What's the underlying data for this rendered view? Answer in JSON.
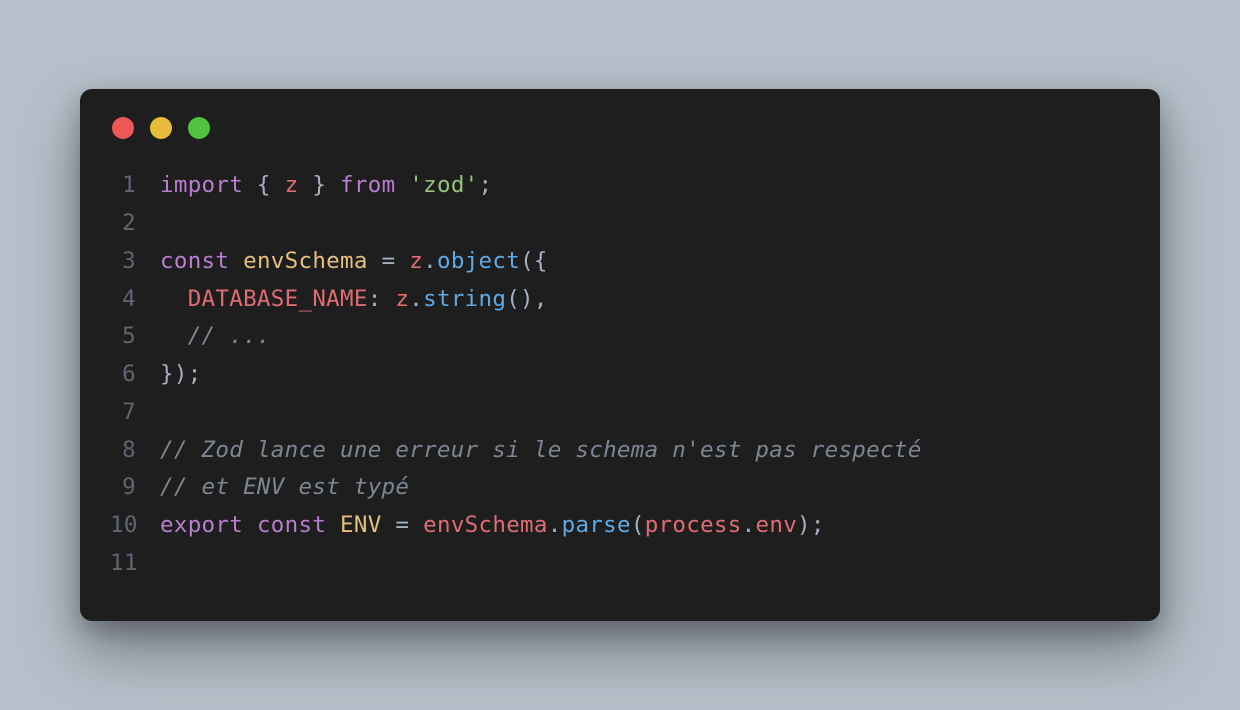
{
  "trafficLights": [
    "red",
    "yellow",
    "green"
  ],
  "lines": [
    {
      "num": "1",
      "tokens": [
        {
          "cls": "tok-keyword",
          "text": "import"
        },
        {
          "cls": "tok-punct",
          "text": " { "
        },
        {
          "cls": "tok-variable",
          "text": "z"
        },
        {
          "cls": "tok-punct",
          "text": " } "
        },
        {
          "cls": "tok-from",
          "text": "from"
        },
        {
          "cls": "tok-punct",
          "text": " "
        },
        {
          "cls": "tok-string",
          "text": "'zod'"
        },
        {
          "cls": "tok-punct",
          "text": ";"
        }
      ]
    },
    {
      "num": "2",
      "tokens": []
    },
    {
      "num": "3",
      "tokens": [
        {
          "cls": "tok-keyword",
          "text": "const"
        },
        {
          "cls": "tok-punct",
          "text": " "
        },
        {
          "cls": "tok-ident",
          "text": "envSchema"
        },
        {
          "cls": "tok-punct",
          "text": " = "
        },
        {
          "cls": "tok-variable",
          "text": "z"
        },
        {
          "cls": "tok-punct",
          "text": "."
        },
        {
          "cls": "tok-method",
          "text": "object"
        },
        {
          "cls": "tok-punct",
          "text": "({"
        }
      ]
    },
    {
      "num": "4",
      "tokens": [
        {
          "cls": "tok-punct",
          "text": "  "
        },
        {
          "cls": "tok-property",
          "text": "DATABASE_NAME"
        },
        {
          "cls": "tok-punct",
          "text": ": "
        },
        {
          "cls": "tok-variable",
          "text": "z"
        },
        {
          "cls": "tok-punct",
          "text": "."
        },
        {
          "cls": "tok-method",
          "text": "string"
        },
        {
          "cls": "tok-punct",
          "text": "(),"
        }
      ]
    },
    {
      "num": "5",
      "tokens": [
        {
          "cls": "tok-punct",
          "text": "  "
        },
        {
          "cls": "tok-comment",
          "text": "// ..."
        }
      ]
    },
    {
      "num": "6",
      "tokens": [
        {
          "cls": "tok-punct",
          "text": "});"
        }
      ]
    },
    {
      "num": "7",
      "tokens": []
    },
    {
      "num": "8",
      "tokens": [
        {
          "cls": "tok-comment",
          "text": "// Zod lance une erreur si le schema n'est pas respecté"
        }
      ]
    },
    {
      "num": "9",
      "tokens": [
        {
          "cls": "tok-comment",
          "text": "// et ENV est typé"
        }
      ]
    },
    {
      "num": "10",
      "tokens": [
        {
          "cls": "tok-keyword",
          "text": "export"
        },
        {
          "cls": "tok-punct",
          "text": " "
        },
        {
          "cls": "tok-keyword",
          "text": "const"
        },
        {
          "cls": "tok-punct",
          "text": " "
        },
        {
          "cls": "tok-const",
          "text": "ENV"
        },
        {
          "cls": "tok-punct",
          "text": " = "
        },
        {
          "cls": "tok-variable",
          "text": "envSchema"
        },
        {
          "cls": "tok-punct",
          "text": "."
        },
        {
          "cls": "tok-method",
          "text": "parse"
        },
        {
          "cls": "tok-punct",
          "text": "("
        },
        {
          "cls": "tok-variable",
          "text": "process"
        },
        {
          "cls": "tok-punct",
          "text": "."
        },
        {
          "cls": "tok-variable",
          "text": "env"
        },
        {
          "cls": "tok-punct",
          "text": ");"
        }
      ]
    },
    {
      "num": "11",
      "tokens": []
    }
  ]
}
